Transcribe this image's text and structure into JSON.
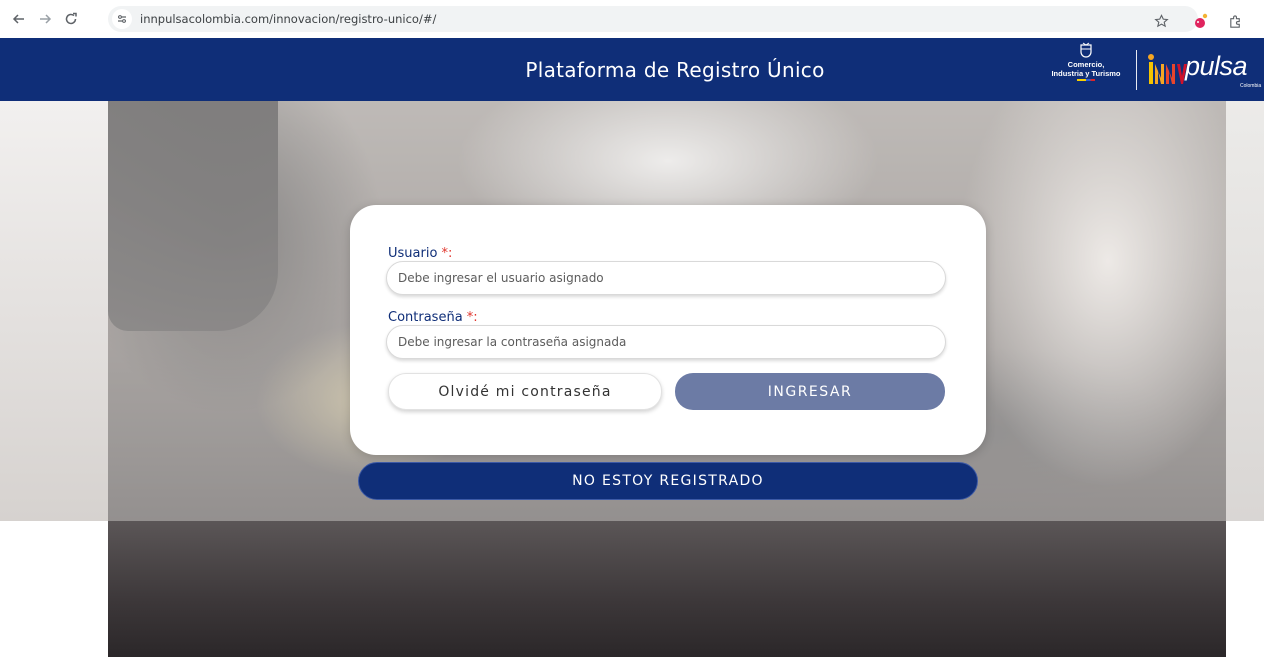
{
  "browser": {
    "url": "innpulsacolombia.com/innovacion/registro-unico/#/",
    "icons": [
      "back-arrow-icon",
      "forward-arrow-icon",
      "reload-icon",
      "site-info-icon",
      "bookmark-star-icon",
      "extension-icon",
      "puzzle-icon"
    ]
  },
  "header": {
    "title": "Plataforma de Registro Único",
    "ministry_line1": "Comercio,",
    "ministry_line2": "Industria y Turismo",
    "brand_name": "pulsa",
    "brand_country": "Colombia",
    "brand_color": "#0f2e78"
  },
  "login": {
    "user_label": "Usuario ",
    "user_required": "*:",
    "user_placeholder": "Debe ingresar el usuario asignado",
    "password_label": "Contraseña ",
    "password_required": "*:",
    "password_placeholder": "Debe ingresar la contraseña asignada",
    "forgot_label": "Olvidé mi contraseña",
    "submit_label": "INGRESAR",
    "submit_color": "#6c7ba5"
  },
  "register": {
    "label": "NO ESTOY REGISTRADO"
  }
}
